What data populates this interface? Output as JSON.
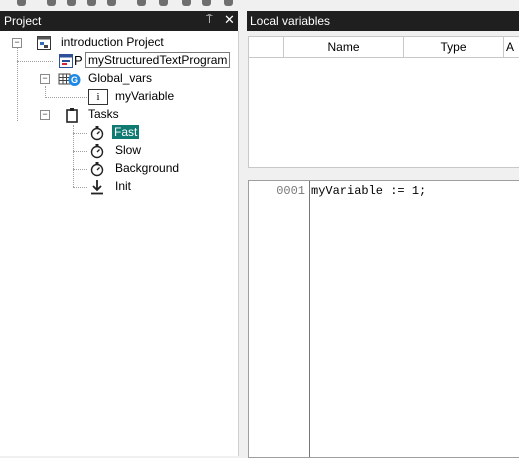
{
  "project_pane": {
    "title": "Project",
    "pin_symbol": "⍑",
    "close_symbol": "✕",
    "tree": {
      "root": {
        "label": "introduction Project",
        "expander": "−",
        "icon": "project-icon"
      },
      "program": {
        "label": "myStructuredTextProgram",
        "prefix": "P",
        "icon": "program-icon"
      },
      "global_vars": {
        "label": "Global_vars",
        "expander": "−",
        "icon": "global-vars-icon",
        "badge": "G"
      },
      "variable": {
        "label": "myVariable",
        "icon": "variable-icon",
        "icon_text": "i"
      },
      "tasks": {
        "label": "Tasks",
        "expander": "−",
        "icon": "clipboard-icon"
      },
      "task_items": [
        {
          "label": "Fast",
          "icon": "stopwatch-icon",
          "selected": true
        },
        {
          "label": "Slow",
          "icon": "stopwatch-icon",
          "selected": false
        },
        {
          "label": "Background",
          "icon": "stopwatch-icon",
          "selected": false
        },
        {
          "label": "Init",
          "icon": "download-arrow-icon",
          "selected": false
        }
      ]
    }
  },
  "local_variables": {
    "title": "Local variables",
    "columns": [
      "",
      "Name",
      "Type",
      "A"
    ]
  },
  "editor": {
    "line_number": "0001",
    "code": "myVariable := 1;"
  },
  "colors": {
    "header_bg": "#1f1f1f",
    "selection": "#0e7a72"
  }
}
